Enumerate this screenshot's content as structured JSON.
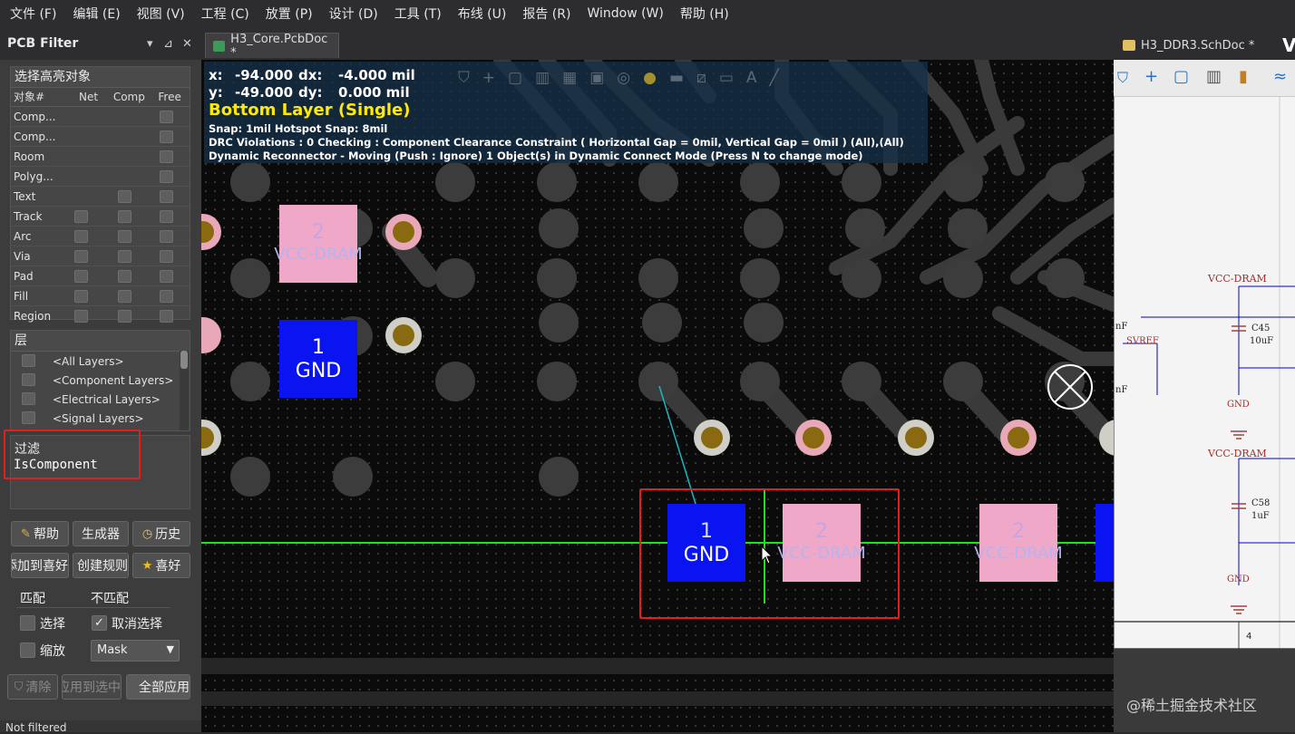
{
  "menu": [
    "文件 (F)",
    "编辑 (E)",
    "视图 (V)",
    "工程 (C)",
    "放置 (P)",
    "设计 (D)",
    "工具 (T)",
    "布线 (U)",
    "报告 (R)",
    "Window (W)",
    "帮助 (H)"
  ],
  "panel": {
    "title": "PCB Filter",
    "pin_glyph": "▾ ⊿ ✕",
    "highlight_group": {
      "title": "选择高亮对象",
      "columns": [
        "对象#",
        "Net",
        "Comp",
        "Free"
      ],
      "rows": [
        {
          "label": "Comp..."
        },
        {
          "label": "Comp..."
        },
        {
          "label": "Room"
        },
        {
          "label": "Polyg..."
        },
        {
          "label": "Text"
        },
        {
          "label": "Track"
        },
        {
          "label": "Arc"
        },
        {
          "label": "Via"
        },
        {
          "label": "Pad"
        },
        {
          "label": "Fill"
        },
        {
          "label": "Region"
        }
      ]
    },
    "layers_group": {
      "title": "层",
      "items": [
        "<All Layers>",
        "<Component Layers>",
        "<Electrical Layers>",
        "<Signal Layers>"
      ]
    },
    "filter": {
      "title": "过滤",
      "query": "IsComponent"
    },
    "buttons": {
      "help": "帮助",
      "builder": "生成器",
      "history": "历史",
      "add_fav": "添加到喜好",
      "create_rule": "创建规则",
      "favorite": "喜好"
    },
    "match_label": "匹配",
    "nomatch_label": "不匹配",
    "select_label": "选择",
    "deselect_label": "取消选择",
    "zoom_label": "缩放",
    "mask_value": "Mask",
    "clear_label": "清除",
    "apply_label": "应用到选中",
    "apply_all_label": "全部应用",
    "status": "Not filtered"
  },
  "tabs": {
    "pcb": "H3_Core.PcbDoc *",
    "sch": "H3_DDR3.SchDoc *",
    "sch_partial": "V"
  },
  "hud": {
    "x_label": "x:",
    "x_value": "-94.000",
    "dx_label": "dx:",
    "dx_value": "-4.000 mil",
    "y_label": "y:",
    "y_value": "-49.000",
    "dy_label": "dy:",
    "dy_value": "0.000 mil",
    "layer": "Bottom Layer (Single)",
    "snap": "Snap: 1mil Hotspot Snap: 8mil",
    "drc": "DRC Violations : 0 Checking : Component Clearance Constraint ( Horizontal Gap = 0mil, Vertical Gap = 0mil ) (All),(All)",
    "reconnect": "Dynamic Reconnector - Moving (Push : Ignore) 1 Object(s) in Dynamic Connect Mode (Press N to change mode)"
  },
  "pads": {
    "top_pink": {
      "num": "2",
      "net": "VCC-DRAM"
    },
    "top_blue": {
      "num": "1",
      "net": "GND"
    },
    "sel_blue": {
      "num": "1",
      "net": "GND"
    },
    "sel_pink": {
      "num": "2",
      "net": "VCC-DRAM"
    },
    "right_pink": {
      "num": "2",
      "net": "VCC-DRAM"
    }
  },
  "schematic": {
    "net1": "VCC-DRAM",
    "net2": "VCC-DRAM",
    "c1": "C45",
    "c1v": "10uF",
    "c2": "C58",
    "c2v": "1uF",
    "svref": "SVREF",
    "gnd1": "GND",
    "gnd2": "GND",
    "mf1": "nF",
    "mf2": "nF",
    "sheet_num": "4"
  },
  "watermark": "@稀土掘金技术社区",
  "colors": {
    "pad_pink": "#f0a8c8",
    "pad_blue": "#0a14f0",
    "via_gold": "#8a6a10",
    "grid_line": "#22dd22",
    "highlight_red": "#e02020"
  }
}
